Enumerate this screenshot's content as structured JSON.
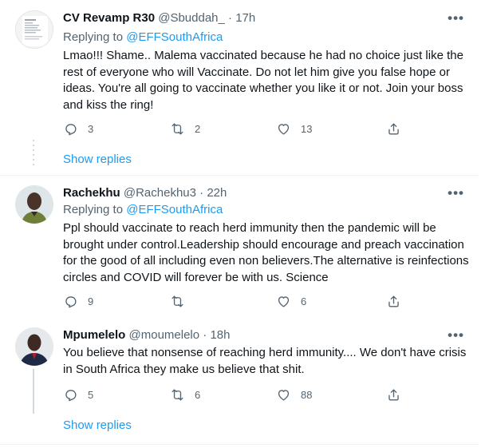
{
  "tweets": [
    {
      "name": "CV Revamp R30",
      "handle": "@Sbuddah_",
      "time": "· 17h",
      "replying_prefix": "Replying to ",
      "replying_to": "@EFFSouthAfrica",
      "text": "Lmao!!! Shame.. Malema vaccinated because he had no choice just like the rest of everyone who will Vaccinate. Do not let him give you false hope or ideas. You're all going to vaccinate whether you like it or not. Join your boss and kiss the ring!",
      "replies": "3",
      "retweets": "2",
      "likes": "13",
      "show_replies": "Show replies"
    },
    {
      "name": "Rachekhu",
      "handle": "@Rachekhu3",
      "time": "· 22h",
      "replying_prefix": "Replying to ",
      "replying_to": "@EFFSouthAfrica",
      "text": "Ppl should vaccinate to reach herd immunity then the pandemic will be brought under control.Leadership should encourage and preach vaccination for the good of all including even non believers.The alternative is reinfections circles and COVID will forever be with us. Science",
      "replies": "9",
      "retweets": "",
      "likes": "6"
    },
    {
      "name": "Mpumelelo",
      "handle": "@moumelelo",
      "time": "· 18h",
      "text": "You believe that nonsense of reaching herd immunity.... We don't have crisis in South Africa they make us believe that shit.",
      "replies": "5",
      "retweets": "6",
      "likes": "88",
      "show_replies": "Show replies"
    }
  ],
  "more_icon": "•••",
  "colors": {
    "link": "#1d9bf0",
    "muted": "#536471",
    "text": "#0f1419",
    "divider": "#eff3f4"
  }
}
